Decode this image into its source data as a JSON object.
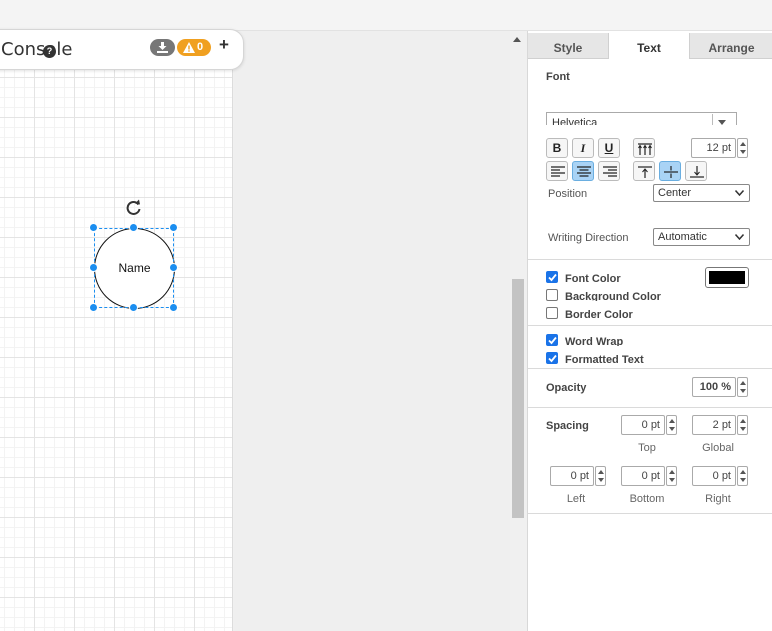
{
  "console": {
    "title": "Console",
    "warning_count": "0"
  },
  "shape": {
    "label": "Name"
  },
  "panel": {
    "tabs": [
      {
        "label": "Style"
      },
      {
        "label": "Text"
      },
      {
        "label": "Arrange"
      }
    ],
    "font": {
      "section_title": "Font",
      "family": "Helvetica",
      "size": "12 pt",
      "bold_label": "B",
      "italic_label": "I",
      "underline_label": "U"
    },
    "position": {
      "label": "Position",
      "value": "Center"
    },
    "writing_direction": {
      "label": "Writing Direction",
      "value": "Automatic"
    },
    "colors": {
      "font_color_label": "Font Color",
      "font_color_checked": true,
      "font_color_value": "#000000",
      "background_color_label": "Background Color",
      "background_color_checked": false,
      "border_color_label": "Border Color",
      "border_color_checked": false
    },
    "options": {
      "word_wrap_label": "Word Wrap",
      "word_wrap_checked": true,
      "formatted_text_label": "Formatted Text",
      "formatted_text_checked": true
    },
    "opacity": {
      "label": "Opacity",
      "value": "100 %"
    },
    "spacing": {
      "label": "Spacing",
      "top": "0 pt",
      "top_label": "Top",
      "global": "2 pt",
      "global_label": "Global",
      "left": "0 pt",
      "left_label": "Left",
      "bottom": "0 pt",
      "bottom_label": "Bottom",
      "right": "0 pt",
      "right_label": "Right"
    }
  },
  "colors": {
    "accent": "#1b8ef0",
    "warning": "#f0a020",
    "checkbox": "#1a73e8"
  }
}
